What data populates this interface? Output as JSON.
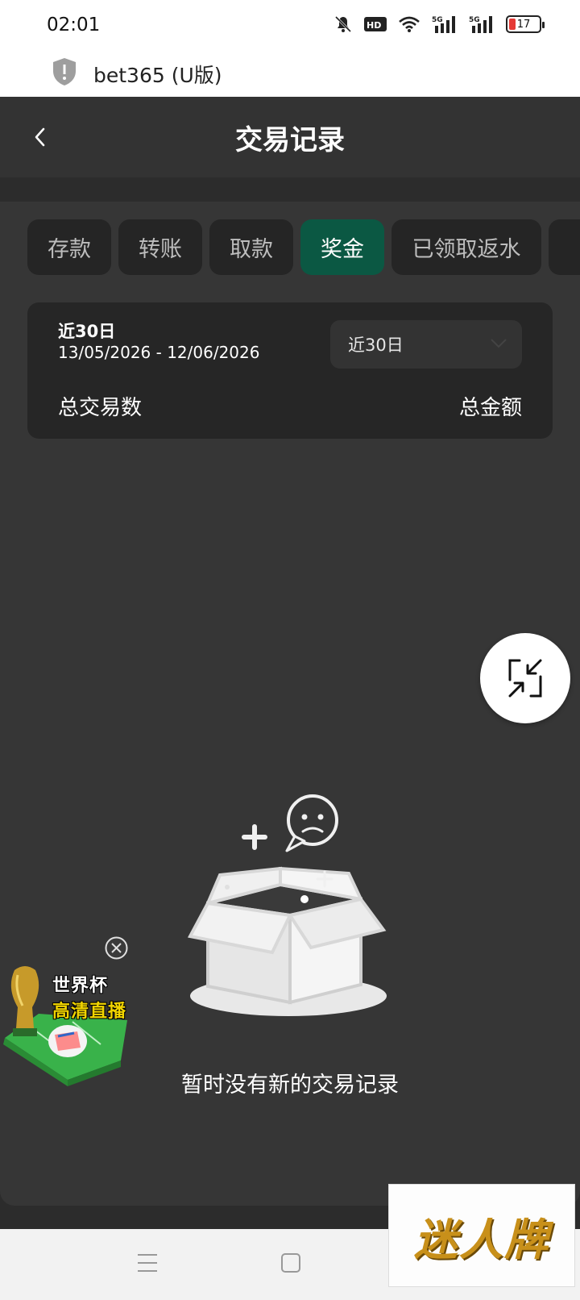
{
  "status_bar": {
    "time": "02:01",
    "icons": [
      "mute-icon",
      "hd-icon",
      "wifi-icon",
      "5g-signal-icon",
      "5g-signal-icon"
    ],
    "battery": "17"
  },
  "app_bar": {
    "name": "bet365 (U版)"
  },
  "header": {
    "title": "交易记录"
  },
  "tabs": [
    {
      "label": "存款",
      "active": false
    },
    {
      "label": "转账",
      "active": false
    },
    {
      "label": "取款",
      "active": false
    },
    {
      "label": "奖金",
      "active": true
    },
    {
      "label": "已领取返水",
      "active": false
    }
  ],
  "summary": {
    "period_label": "近30日",
    "period_range": "13/05/2026 - 12/06/2026",
    "period_select": "近30日",
    "total_count_label": "总交易数",
    "total_amount_label": "总金额"
  },
  "empty_state": {
    "message": "暂时没有新的交易记录"
  },
  "ad": {
    "line1": "世界杯",
    "line2": "高清直播"
  },
  "watermark": {
    "text": "迷人牌"
  },
  "colors": {
    "accent": "#0b5843",
    "background": "#2c2c2c",
    "card": "#262626"
  }
}
